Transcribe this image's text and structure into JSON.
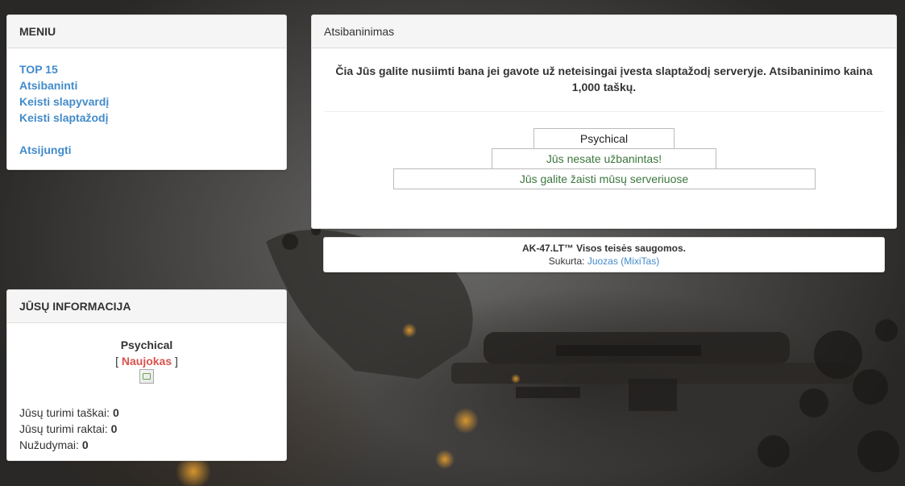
{
  "menu": {
    "title": "MENIU",
    "items": [
      {
        "label": "TOP 15"
      },
      {
        "label": "Atsibaninti"
      },
      {
        "label": "Keisti slapyvardį"
      },
      {
        "label": "Keisti slaptažodį"
      }
    ],
    "logout_label": "Atsijungti"
  },
  "info": {
    "title": "JŪSŲ INFORMACIJA",
    "username": "Psychical",
    "rank_open": "[",
    "rank": "Naujokas",
    "rank_close": "]",
    "stats": [
      {
        "label": "Jūsų turimi taškai:",
        "value": "0"
      },
      {
        "label": "Jūsų turimi raktai:",
        "value": "0"
      },
      {
        "label": "Nužudymai:",
        "value": "0"
      }
    ]
  },
  "unban": {
    "title": "Atsibaninimas",
    "description": "Čia Jūs galite nusiimti bana jei gavote už neteisingai įvesta slaptažodį serveryje. Atsibaninimo kaina 1,000 taškų.",
    "player_name": "Psychical",
    "status_not_banned": "Jūs nesate užbanintas!",
    "status_can_play": "Jūs galite žaisti mūsų serveriuose"
  },
  "footer": {
    "copyright": "AK-47.LT™ Visos teisės saugomos.",
    "created_by": "Sukurta:",
    "author_name": "Juozas",
    "author_nick": "(MixiTas)"
  },
  "colors": {
    "link": "#428bca",
    "success": "#3c763d",
    "rank": "#d9534f",
    "panel_heading": "#f5f5f5"
  }
}
